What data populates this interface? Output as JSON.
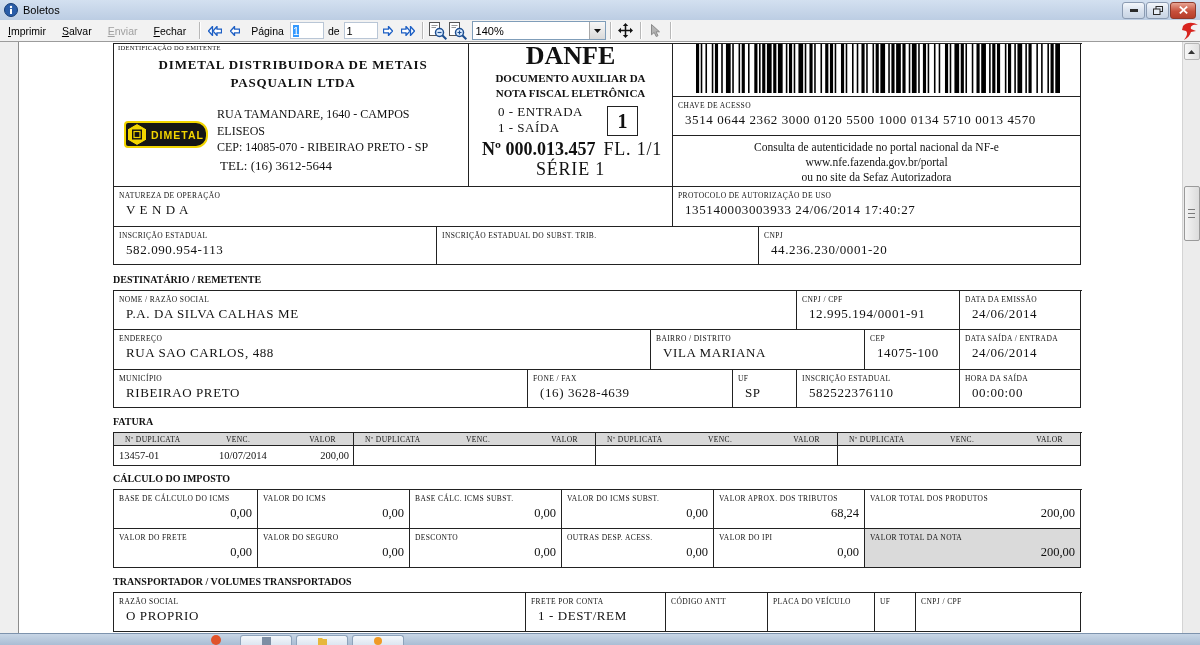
{
  "window": {
    "title": "Boletos"
  },
  "toolbar": {
    "actions": [
      {
        "label": "Imprimir",
        "disabled": false
      },
      {
        "label": "Salvar",
        "disabled": false
      },
      {
        "label": "Enviar",
        "disabled": true
      },
      {
        "label": "Fechar",
        "disabled": false
      }
    ],
    "page_label": "Página",
    "page_value": "1",
    "of_label": "de",
    "page_total": "1",
    "zoom": "140%"
  },
  "emitter": {
    "label": "IDENTIFICAÇÃO DO EMITENTE",
    "name": "DIMETAL DISTRIBUIDORA DE METAIS PASQUALIN LTDA",
    "logo_text": "DIMETAL",
    "address": "RUA TAMANDARE, 1640 - CAMPOS ELISEOS",
    "city_line": "CEP: 14085-070 - RIBEIRAO PRETO - SP",
    "phone": "TEL: (16) 3612-5644"
  },
  "danfe": {
    "title": "DANFE",
    "subtitle_lines": [
      "DOCUMENTO AUXILIAR DA",
      "NOTA FISCAL ELETRÔNICA"
    ],
    "operation_types": [
      "0 - ENTRADA",
      "1 - SAÍDA"
    ],
    "operation_code": "1",
    "number": "Nº 000.013.457",
    "sheet": "FL. 1/1",
    "series": "SÉRIE 1"
  },
  "access_key": {
    "label": "CHAVE DE ACESSO",
    "value": "3514 0644 2362 3000 0120 5500 1000 0134 5710 0013 4570"
  },
  "verification_lines": [
    "Consulta de autenticidade no portal nacional da NF-e",
    "www.nfe.fazenda.gov.br/portal",
    "ou no site da Sefaz Autorizadora"
  ],
  "issuer_lines": [
    {
      "fields": [
        {
          "label": "NATUREZA DE OPERAÇÃO",
          "value": "V E N D A"
        },
        {
          "label": "PROTOCOLO DE AUTORIZAÇÃO DE USO",
          "value": "135140003003933 24/06/2014 17:40:27"
        }
      ]
    },
    {
      "fields": [
        {
          "label": "INSCRIÇÃO ESTADUAL",
          "value": "582.090.954-113"
        },
        {
          "label": "INSCRIÇÃO ESTADUAL DO SUBST. TRIB."
        },
        {
          "label": "CNPJ",
          "value": "44.236.230/0001-20"
        }
      ]
    }
  ],
  "recipient": {
    "heading": "DESTINATÁRIO / REMETENTE",
    "lines": [
      {
        "fields": [
          {
            "label": "NOME / RAZÃO SOCIAL",
            "value": "P.A. DA SILVA CALHAS ME"
          },
          {
            "label": "CNPJ / CPF",
            "value": "12.995.194/0001-91"
          },
          {
            "label": "DATA DA EMISSÃO",
            "value": "24/06/2014"
          }
        ]
      },
      {
        "fields": [
          {
            "label": "ENDEREÇO",
            "value": "RUA SAO CARLOS, 488"
          },
          {
            "label": "BAIRRO / DISTRITO",
            "value": "VILA MARIANA"
          },
          {
            "label": "CEP",
            "value": "14075-100"
          },
          {
            "label": "DATA SAÍDA / ENTRADA",
            "value": "24/06/2014"
          }
        ]
      },
      {
        "fields": [
          {
            "label": "MUNICÍPIO",
            "value": "RIBEIRAO PRETO"
          },
          {
            "label": "FONE / FAX",
            "value": "(16) 3628-4639"
          },
          {
            "label": "UF",
            "value": "SP"
          },
          {
            "label": "INSCRIÇÃO ESTADUAL",
            "value": "582522376110"
          },
          {
            "label": "HORA DA SAÍDA",
            "value": "00:00:00"
          }
        ]
      }
    ]
  },
  "invoice": {
    "heading": "FATURA",
    "groups": [
      {
        "columns": [
          "Nº DUPLICATA",
          "VENC.",
          "VALOR"
        ],
        "values": [
          "13457-01",
          "10/07/2014",
          "200,00"
        ]
      },
      {
        "columns": [
          "Nº DUPLICATA",
          "VENC.",
          "VALOR"
        ]
      },
      {
        "columns": [
          "Nº DUPLICATA",
          "VENC.",
          "VALOR"
        ]
      },
      {
        "columns": [
          "Nº DUPLICATA",
          "VENC.",
          "VALOR"
        ]
      }
    ]
  },
  "tax": {
    "heading": "CÁLCULO DO IMPOSTO",
    "rows": [
      [
        {
          "label": "BASE DE CÁLCULO DO ICMS",
          "value": "0,00",
          "highlighted": false
        },
        {
          "label": "VALOR DO ICMS",
          "value": "0,00",
          "highlighted": false
        },
        {
          "label": "BASE CÁLC. ICMS SUBST.",
          "value": "0,00",
          "highlighted": false
        },
        {
          "label": "VALOR DO ICMS SUBST.",
          "value": "0,00",
          "highlighted": false
        },
        {
          "label": "VALOR APROX. DOS TRIBUTOS",
          "value": "68,24",
          "highlighted": false
        },
        {
          "label": "VALOR TOTAL DOS PRODUTOS",
          "value": "200,00",
          "highlighted": false
        }
      ],
      [
        {
          "label": "VALOR DO FRETE",
          "value": "0,00",
          "highlighted": false
        },
        {
          "label": "VALOR DO SEGURO",
          "value": "0,00",
          "highlighted": false
        },
        {
          "label": "DESCONTO",
          "value": "0,00",
          "highlighted": false
        },
        {
          "label": "OUTRAS DESP. ACESS.",
          "value": "0,00",
          "highlighted": false
        },
        {
          "label": "VALOR DO IPI",
          "value": "0,00",
          "highlighted": false
        },
        {
          "label": "VALOR TOTAL DA NOTA",
          "value": "200,00",
          "highlighted": true
        }
      ]
    ]
  },
  "carrier": {
    "heading": "TRANSPORTADOR / VOLUMES TRANSPORTADOS",
    "lines": [
      {
        "fields": [
          {
            "label": "RAZÃO SOCIAL",
            "value": "O PROPRIO"
          },
          {
            "label": "FRETE POR CONTA",
            "value": "1 - DEST/REM"
          },
          {
            "label": "CÓDIGO ANTT"
          },
          {
            "label": "PLACA DO VEÍCULO"
          },
          {
            "label": "UF"
          },
          {
            "label": "CNPJ / CPF"
          }
        ]
      }
    ]
  }
}
